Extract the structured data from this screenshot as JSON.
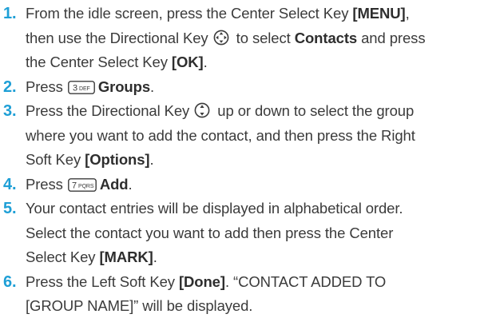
{
  "steps": [
    {
      "num": "1.",
      "l1a": "From the idle screen, press the Center Select Key ",
      "l1b": "[MENU]",
      "l1c": ",",
      "l2a": "then use the Directional Key ",
      "l2b": " to select ",
      "l2c": "Contacts",
      "l2d": " and press",
      "l3a": "the Center Select Key ",
      "l3b": "[OK]",
      "l3c": "."
    },
    {
      "num": "2.",
      "l1a": "Press ",
      "key": "3 DEF",
      "l1b": "Groups",
      "l1c": "."
    },
    {
      "num": "3.",
      "l1a": "Press the Directional Key ",
      "l1b": " up or down to select the group",
      "l2a": "where you want to add the contact, and then press the Right",
      "l3a": "Soft Key ",
      "l3b": "[Options]",
      "l3c": "."
    },
    {
      "num": "4.",
      "l1a": "Press ",
      "key": "7 PQRS",
      "l1b": "Add",
      "l1c": "."
    },
    {
      "num": "5.",
      "l1a": "Your contact entries will be displayed in alphabetical order.",
      "l2a": "Select the contact you want to add then press the Center",
      "l3a": "Select Key ",
      "l3b": "[MARK]",
      "l3c": "."
    },
    {
      "num": "6.",
      "l1a": "Press the Left Soft Key ",
      "l1b": "[Done]",
      "l1c": ". “CONTACT ADDED TO",
      "l2a": "[GROUP NAME]” will be displayed."
    }
  ],
  "colors": {
    "number": "#1e9fd6",
    "text": "#3b3b3b"
  },
  "icons": [
    "directional-key-four-way-icon",
    "directional-key-up-down-icon",
    "key-3-def-icon",
    "key-7-pqrs-icon"
  ]
}
